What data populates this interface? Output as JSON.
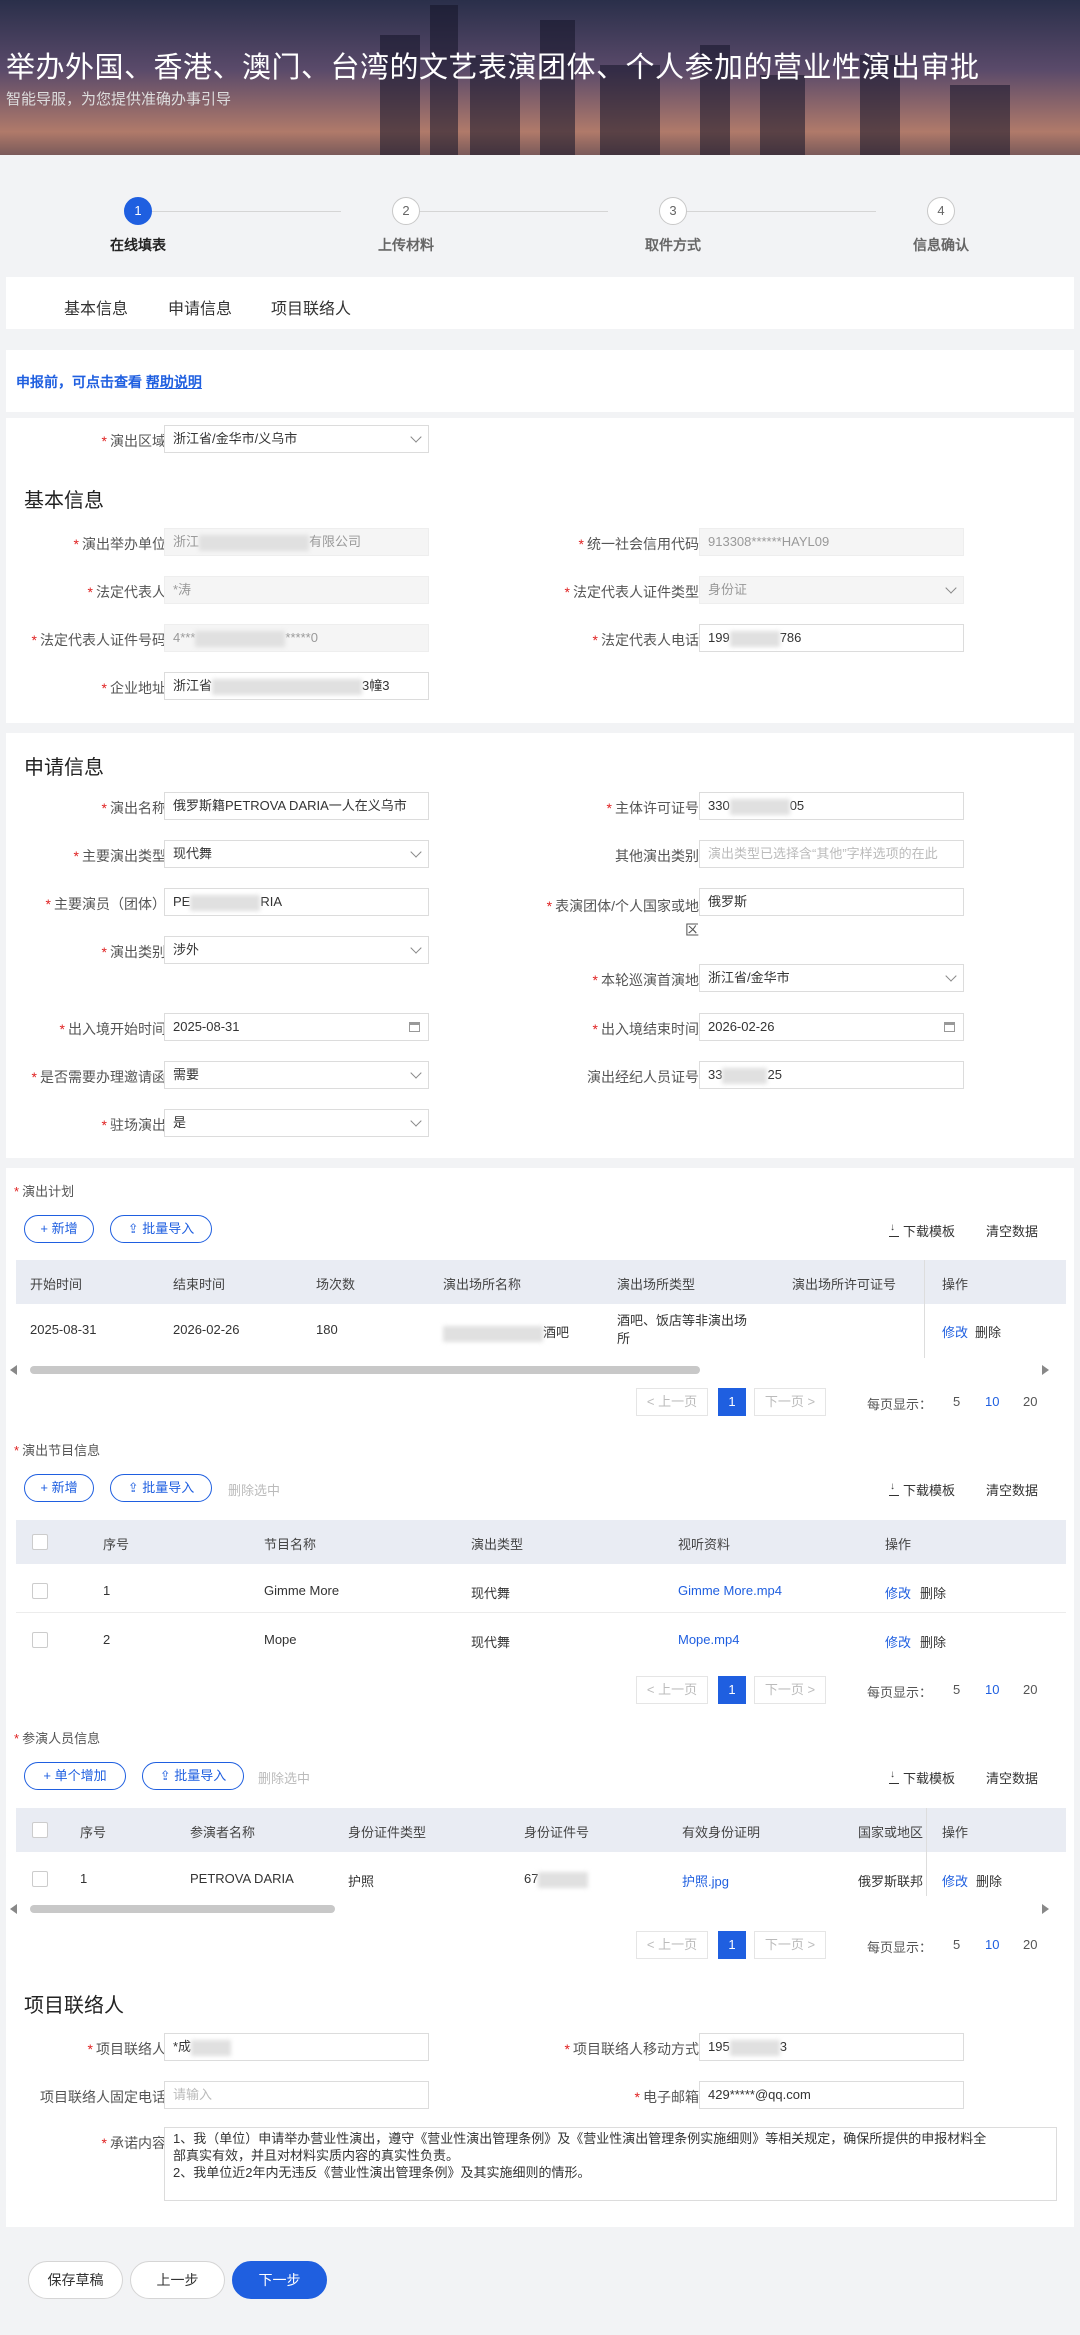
{
  "banner": {
    "title": "举办外国、香港、澳门、台湾的文艺表演团体、个人参加的营业性演出审批",
    "subtitle": "智能导服，为您提供准确办事引导"
  },
  "steps": [
    {
      "num": "1",
      "label": "在线填表"
    },
    {
      "num": "2",
      "label": "上传材料"
    },
    {
      "num": "3",
      "label": "取件方式"
    },
    {
      "num": "4",
      "label": "信息确认"
    }
  ],
  "tabs": [
    "基本信息",
    "申请信息",
    "项目联络人"
  ],
  "notice": {
    "text": "申报前，可点击查看 ",
    "link": "帮助说明"
  },
  "region": {
    "label": "演出区域",
    "value": "浙江省/金华市/义乌市"
  },
  "basic": {
    "title": "基本信息",
    "org_label": "演出举办单位",
    "org_prefix": "浙江",
    "org_suffix": "有限公司",
    "credit_label": "统一社会信用代码",
    "credit_value": "913308******HAYL09",
    "legal_label": "法定代表人",
    "legal_value": "*涛",
    "id_type_label": "法定代表人证件类型",
    "id_type_value": "身份证",
    "id_no_label": "法定代表人证件号码",
    "id_no_prefix": "4***",
    "id_no_suffix": "*****0",
    "phone_label": "法定代表人电话",
    "phone_prefix": "199",
    "phone_suffix": "786",
    "addr_label": "企业地址",
    "addr_prefix": "浙江省",
    "addr_suffix": "3幢3"
  },
  "apply": {
    "title": "申请信息",
    "name_label": "演出名称",
    "name_value": "俄罗斯籍PETROVA DARIA一人在义乌市",
    "permit_label": "主体许可证号",
    "permit_prefix": "330",
    "permit_suffix": "05",
    "type_label": "主要演出类型",
    "type_value": "现代舞",
    "other_type_label": "其他演出类别",
    "other_type_placeholder": "演出类型已选择含“其他”字样选项的在此",
    "performer_label": "主要演员（团体）",
    "performer_prefix": "PE",
    "performer_suffix": "RIA",
    "country_label": "表演团体/个人国家或地区",
    "country_value": "俄罗斯",
    "category_label": "演出类别",
    "category_value": "涉外",
    "first_place_label": "本轮巡演首演地",
    "first_place_value": "浙江省/金华市",
    "start_label": "出入境开始时间",
    "start_value": "2025-08-31",
    "end_label": "出入境结束时间",
    "end_value": "2026-02-26",
    "invite_label": "是否需要办理邀请函",
    "invite_value": "需要",
    "agent_label": "演出经纪人员证号",
    "agent_prefix": "33",
    "agent_suffix": "25",
    "resident_label": "驻场演出",
    "resident_value": "是"
  },
  "plan": {
    "title": "演出计划",
    "add": "+ 新增",
    "import": "批量导入",
    "download": "下载模板",
    "clear": "清空数据",
    "headers": [
      "开始时间",
      "结束时间",
      "场次数",
      "演出场所名称",
      "演出场所类型",
      "演出场所许可证号",
      "操作"
    ],
    "row": {
      "start": "2025-08-31",
      "end": "2026-02-26",
      "count": "180",
      "venue_suffix": "酒吧",
      "venue_type_1": "酒吧、饭店等非演出场",
      "venue_type_2": "所",
      "edit": "修改",
      "delete": "删除"
    }
  },
  "program": {
    "title": "演出节目信息",
    "add": "+ 新增",
    "import": "批量导入",
    "delete_sel": "删除选中",
    "download": "下载模板",
    "clear": "清空数据",
    "headers": [
      "序号",
      "节目名称",
      "演出类型",
      "视听资料",
      "操作"
    ],
    "rows": [
      {
        "no": "1",
        "name": "Gimme More",
        "type": "现代舞",
        "file": "Gimme More.mp4",
        "edit": "修改",
        "delete": "删除"
      },
      {
        "no": "2",
        "name": "Mope",
        "type": "现代舞",
        "file": "Mope.mp4",
        "edit": "修改",
        "delete": "删除"
      }
    ]
  },
  "staff": {
    "title": "参演人员信息",
    "add": "+ 单个增加",
    "import": "批量导入",
    "delete_sel": "删除选中",
    "download": "下载模板",
    "clear": "清空数据",
    "headers": [
      "序号",
      "参演者名称",
      "身份证件类型",
      "身份证件号",
      "有效身份证明",
      "国家或地区",
      "操作"
    ],
    "row": {
      "no": "1",
      "name": "PETROVA DARIA",
      "id_type": "护照",
      "id_prefix": "67",
      "proof": "护照.jpg",
      "country": "俄罗斯联邦",
      "edit": "修改",
      "delete": "删除"
    }
  },
  "pager": {
    "prev": "< 上一页",
    "next": "下一页 >",
    "current": "1",
    "per_label": "每页显示：",
    "opts": [
      "5",
      "10",
      "20"
    ]
  },
  "contact": {
    "title": "项目联络人",
    "name_label": "项目联络人",
    "name_prefix": "*成",
    "mobile_label": "项目联络人移动方式",
    "mobile_prefix": "195",
    "mobile_suffix": "3",
    "tel_label": "项目联络人固定电话",
    "tel_placeholder": "请输入",
    "email_label": "电子邮箱",
    "email_value": "429*****@qq.com",
    "promise_label": "承诺内容",
    "promise_1": "1、我（单位）申请举办营业性演出，遵守《营业性演出管理条例》及《营业性演出管理条例实施细则》等相关规定，确保所提供的申报材料全",
    "promise_2": "部真实有效，并且对材料实质内容的真实性负责。",
    "promise_3": "2、我单位近2年内无违反《营业性演出管理条例》及其实施细则的情形。"
  },
  "footer": {
    "save": "保存草稿",
    "prev": "上一步",
    "next": "下一步"
  }
}
